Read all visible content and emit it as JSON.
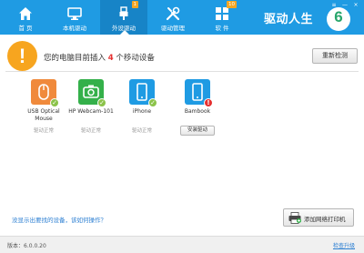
{
  "window_controls": {
    "menu": "≡",
    "minimize": "—",
    "close": "×"
  },
  "nav": {
    "tabs": [
      {
        "label": "首 页",
        "icon": "home-icon",
        "badge": ""
      },
      {
        "label": "本机驱动",
        "icon": "monitor-icon",
        "badge": ""
      },
      {
        "label": "外设驱动",
        "icon": "usb-icon",
        "badge": "1"
      },
      {
        "label": "驱动管理",
        "icon": "tools-icon",
        "badge": ""
      },
      {
        "label": "软 件",
        "icon": "apps-icon",
        "badge": "10"
      }
    ],
    "active_index": 2
  },
  "brand": {
    "name": "驱动人生",
    "logo_number": "6"
  },
  "alert": {
    "icon": "exclamation-icon",
    "prefix": "您的电脑目前插入",
    "count": "4",
    "suffix": "个移动设备"
  },
  "rescan_label": "重新检测",
  "devices": [
    {
      "name": "USB Optical Mouse",
      "status_text": "驱动正常",
      "icon": "mouse-icon",
      "status": "ok",
      "color": "#f08a3c"
    },
    {
      "name": "HP Webcam-101",
      "status_text": "驱动正常",
      "icon": "camera-icon",
      "status": "ok",
      "color": "#34b04a"
    },
    {
      "name": "iPhone",
      "status_text": "驱动正常",
      "icon": "phone-icon",
      "status": "ok",
      "color": "#1f9be3"
    },
    {
      "name": "Bambook",
      "status_text": "",
      "icon": "phone-icon",
      "status": "error",
      "color": "#1f9be3",
      "action": "安装驱动"
    }
  ],
  "help_link": "没显示出要找的设备，该如何操作？",
  "printer_button": "添加网络打印机",
  "footer": {
    "version": "版本：6.0.0.20",
    "upgrade": "检查升级"
  },
  "colors": {
    "header": "#1f9be3",
    "accent": "#f7a51f",
    "ok": "#8bc34a",
    "error": "#e53030"
  }
}
